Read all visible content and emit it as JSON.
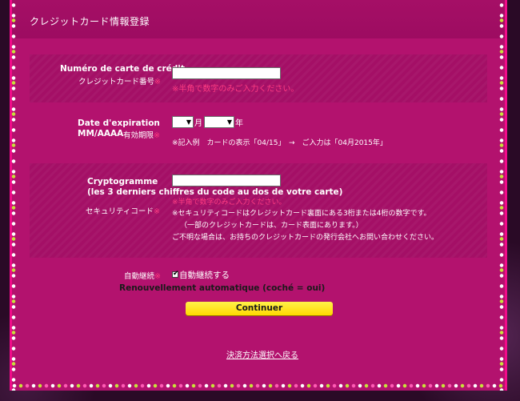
{
  "header": {
    "title": "クレジットカード情報登録"
  },
  "card_number": {
    "label_fr": "Numéro de carte de crédit",
    "label_jp": "クレジットカード番号",
    "required_mark": "※",
    "hint": "※半角で数字のみご入力ください。",
    "value": ""
  },
  "expiry": {
    "label_fr_line1": "Date d'expiration",
    "label_fr_line2": "MM/AAAA",
    "label_jp": "有効期限",
    "required_mark": "※",
    "month_value": "",
    "month_unit": "月",
    "year_value": "",
    "year_unit": "年",
    "example": "※記入例　カードの表示「04/15」　→　ご入力は「04月2015年」"
  },
  "cvv": {
    "label_fr_line1": "Cryptogramme",
    "label_fr_line2": "(les 3 derniers chiffres du code au dos de votre carte)",
    "label_jp": "セキュリティコード",
    "required_mark": "※",
    "hint": "※半角で数字のみご入力ください。",
    "note1": "※セキュリティコードはクレジットカード裏面にある3桁または4桁の数字です。",
    "note2": "（一部のクレジットカードは、カード表面にあります。）",
    "note3": "ご不明な場合は、お持ちのクレジットカードの発行会社へお問い合わせください。",
    "value": ""
  },
  "auto_renew": {
    "label_jp": "自動継続",
    "required_mark": "※",
    "checkbox_label": "自動継続する",
    "checked": true,
    "caption_fr": "Renouvellement automatique (coché = oui)"
  },
  "actions": {
    "continue_label": "Continuer",
    "back_link": "決済方法選択へ戻る"
  },
  "colors": {
    "frame_bg": "#b3126e",
    "frame_border": "#f20b8a",
    "required": "#ff3c82",
    "button": "#ffe400"
  }
}
